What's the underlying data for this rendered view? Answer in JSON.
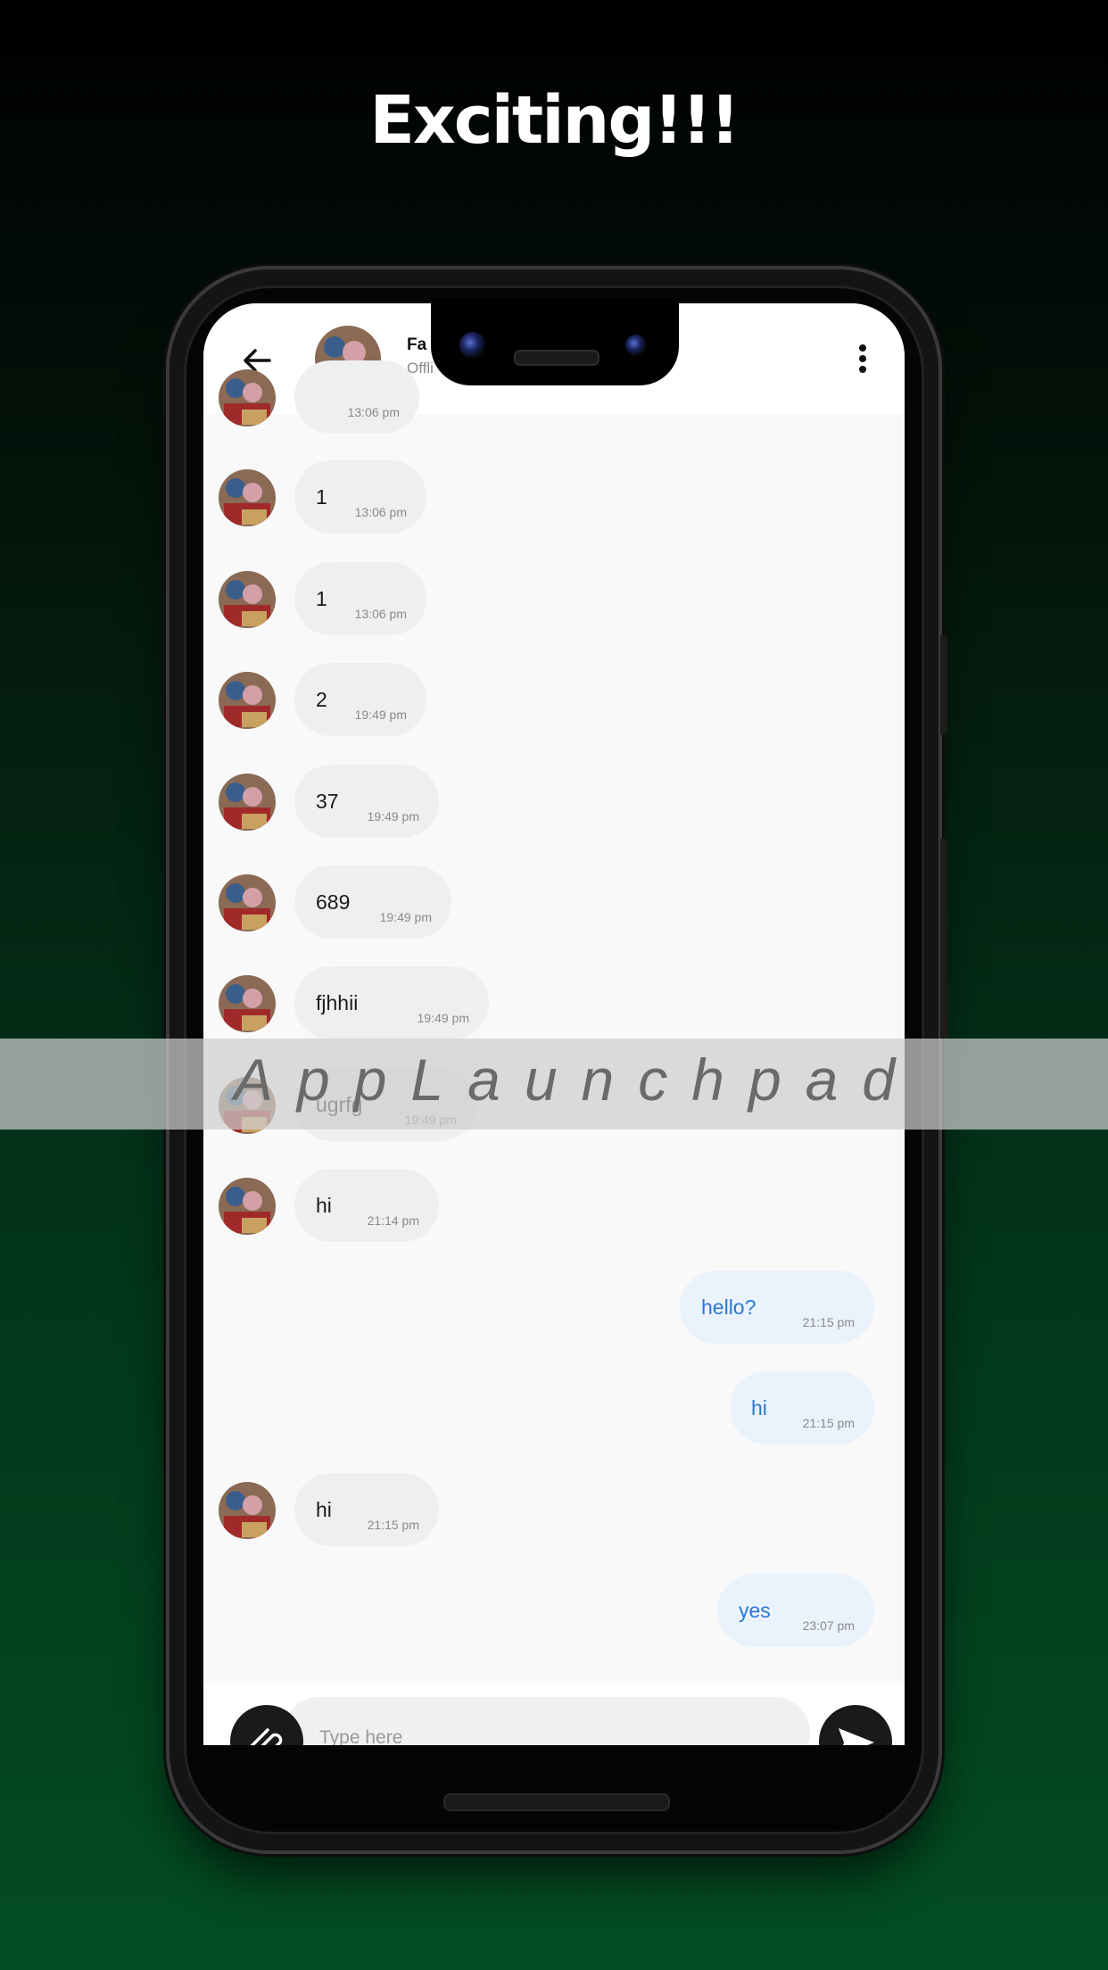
{
  "headline": "Exciting!!!",
  "chat": {
    "contact_name": "Fa",
    "contact_status": "Offli",
    "messages": [
      {
        "side": "received",
        "text": "",
        "time": "13:06 pm"
      },
      {
        "side": "received",
        "text": "1",
        "time": "13:06 pm"
      },
      {
        "side": "received",
        "text": "1",
        "time": "13:06 pm"
      },
      {
        "side": "received",
        "text": "2",
        "time": "19:49 pm"
      },
      {
        "side": "received",
        "text": "37",
        "time": "19:49 pm"
      },
      {
        "side": "received",
        "text": "689",
        "time": "19:49 pm"
      },
      {
        "side": "received",
        "text": "fjhhii",
        "time": "19:49 pm"
      },
      {
        "side": "received",
        "text": "ugrfg",
        "time": "19:49 pm"
      },
      {
        "side": "received",
        "text": "hi",
        "time": "21:14 pm"
      },
      {
        "side": "sent",
        "text": "hello?",
        "time": "21:15 pm"
      },
      {
        "side": "sent",
        "text": "hi",
        "time": "21:15 pm"
      },
      {
        "side": "received",
        "text": "hi",
        "time": "21:15 pm"
      },
      {
        "side": "sent",
        "text": "yes",
        "time": "23:07 pm"
      }
    ],
    "input_placeholder": "Type here"
  },
  "watermark": "AppLaunchpad",
  "icons": {
    "back": "arrow-left-icon",
    "more": "more-vertical-icon",
    "attach": "paperclip-icon",
    "send": "send-icon"
  },
  "colors": {
    "sent_text": "#2a78d6",
    "sent_bubble": "#eaf2fc",
    "received_bubble": "#efefef"
  }
}
